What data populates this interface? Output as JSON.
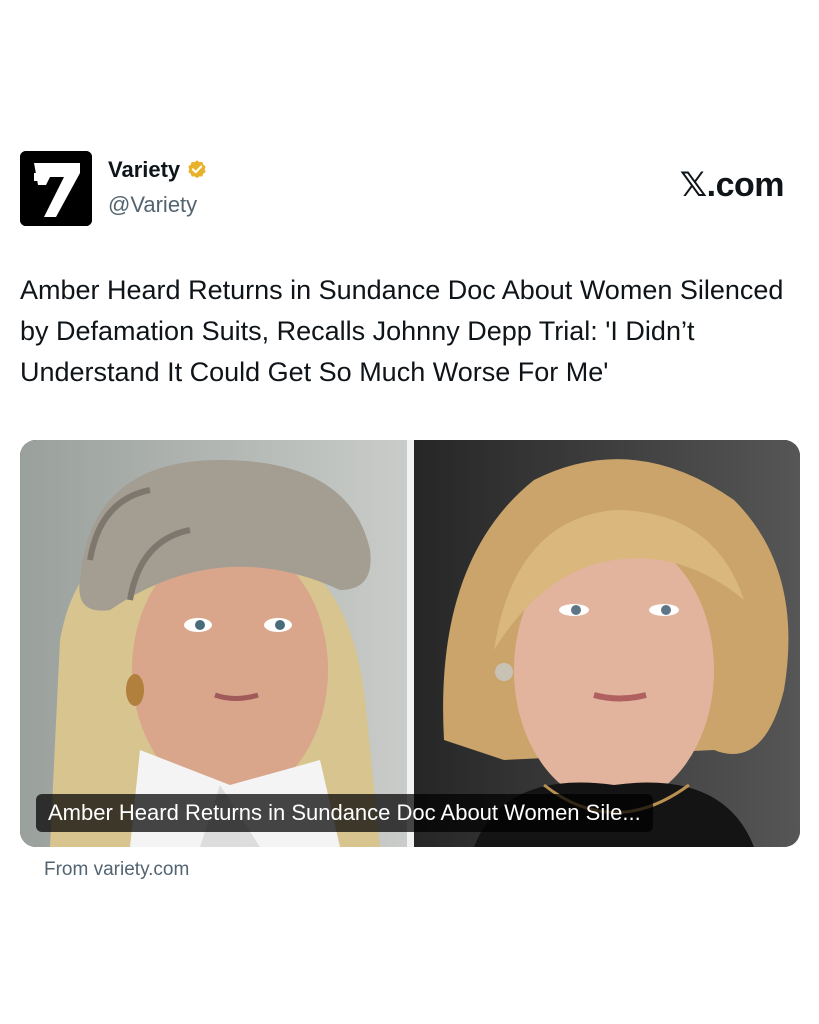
{
  "account": {
    "name": "Variety",
    "handle": "@Variety",
    "avatar_icon": "variety-logo-icon",
    "verified_icon": "verified-badge-icon",
    "verified_color": "#e8b22a"
  },
  "platform": {
    "label": "𝕏.com"
  },
  "post": {
    "headline": "Amber Heard Returns in Sundance Doc About Women Silenced by Defamation Suits, Recalls Johnny Depp Trial: 'I Didn’t Understand It Could Get So Much Worse For Me'"
  },
  "card": {
    "caption": "Amber Heard Returns in Sundance Doc About Women Sile...",
    "source": "From variety.com"
  }
}
